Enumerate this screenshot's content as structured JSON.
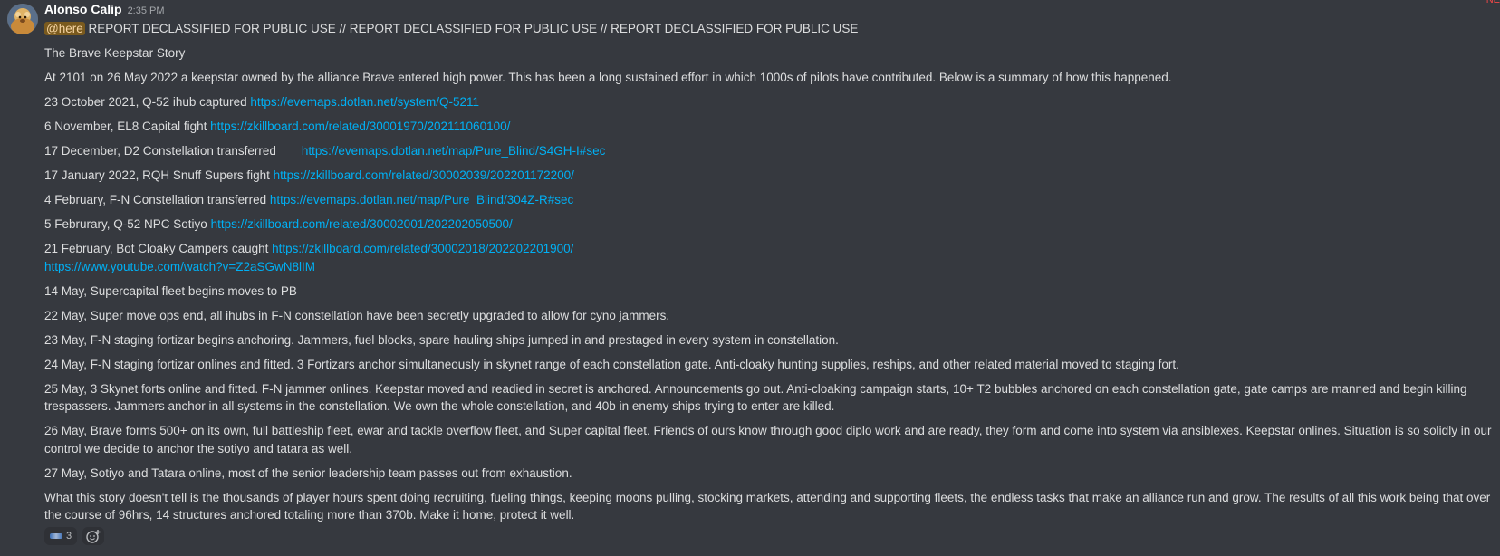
{
  "message": {
    "author": "Alonso Calip",
    "timestamp": "2:35 PM",
    "corner_mark": "NE",
    "mention": "@here",
    "headline": " REPORT DECLASSIFIED FOR PUBLIC USE // REPORT DECLASSIFIED FOR PUBLIC USE // REPORT DECLASSIFIED FOR PUBLIC USE",
    "title": "The Brave Keepstar Story",
    "intro": "At 2101 on 26 May 2022 a keepstar owned by the alliance Brave entered high power. This has been a long sustained effort in which 1000s of pilots have contributed. Below is a summary of how this happened.",
    "events": [
      {
        "text": "23 October 2021, Q-52 ihub captured ",
        "link": "https://evemaps.dotlan.net/system/Q-5211"
      },
      {
        "text": "6 November, EL8 Capital fight ",
        "link": "https://zkillboard.com/related/30001970/202111060100/"
      },
      {
        "text": "17 December, D2 Constellation transferred",
        "link": "https://evemaps.dotlan.net/map/Pure_Blind/S4GH-I#sec"
      },
      {
        "text": "17 January 2022, RQH Snuff Supers fight ",
        "link": "https://zkillboard.com/related/30002039/202201172200/"
      },
      {
        "text": "4 February, F-N Constellation transferred ",
        "link": "https://evemaps.dotlan.net/map/Pure_Blind/304Z-R#sec"
      },
      {
        "text": "5 Februrary, Q-52 NPC Sotiyo ",
        "link": "https://zkillboard.com/related/30002001/202202050500/"
      },
      {
        "text": "21 February, Bot Cloaky Campers caught  ",
        "link": "https://zkillboard.com/related/30002018/202202201900/",
        "link2": "https://www.youtube.com/watch?v=Z2aSGwN8lIM"
      }
    ],
    "paragraphs": [
      "14 May, Supercapital fleet begins moves to PB",
      "22 May, Super move ops end, all ihubs in F-N constellation have been secretly upgraded to allow for cyno jammers.",
      "23 May, F-N staging fortizar begins anchoring. Jammers, fuel blocks, spare hauling ships jumped in and prestaged in every system in constellation.",
      "24 May, F-N staging fortizar onlines and fitted. 3 Fortizars anchor simultaneously in skynet range of each constellation gate. Anti-cloaky hunting supplies, reships, and other related material moved to staging fort.",
      "25 May, 3 Skynet forts online and fitted. F-N jammer onlines. Keepstar moved and readied in secret is anchored. Announcements go out. Anti-cloaking campaign starts, 10+ T2 bubbles anchored on each constellation gate, gate camps are manned and begin killing trespassers. Jammers anchor in all systems in the constellation. We own the whole constellation, and 40b in enemy ships trying to enter are killed.",
      "26 May, Brave forms 500+ on its own, full battleship fleet, ewar and tackle overflow fleet, and Super capital fleet. Friends of ours know through good diplo work and are ready, they form and come into system via ansiblexes. Keepstar onlines. Situation is so solidly in our control we decide to anchor the sotiyo and tatara as well.",
      "27 May, Sotiyo and Tatara online, most of the senior leadership team passes out from exhaustion.",
      "What this story doesn't tell is the thousands of player hours spent doing recruiting, fueling things, keeping moons pulling, stocking markets, attending and supporting fleets, the endless tasks that make an alliance run and grow. The results of all this work being that over the course of 96hrs, 14 structures anchored totaling more than 370b. Make it home, protect it well."
    ],
    "reactions": [
      {
        "emoji": "brave-emoji",
        "count": "3"
      }
    ]
  },
  "colors": {
    "background": "#36393f",
    "text": "#dcddde",
    "link": "#00b0f4",
    "mention_bg": "#7a5a1e",
    "author": "#ffffff"
  }
}
